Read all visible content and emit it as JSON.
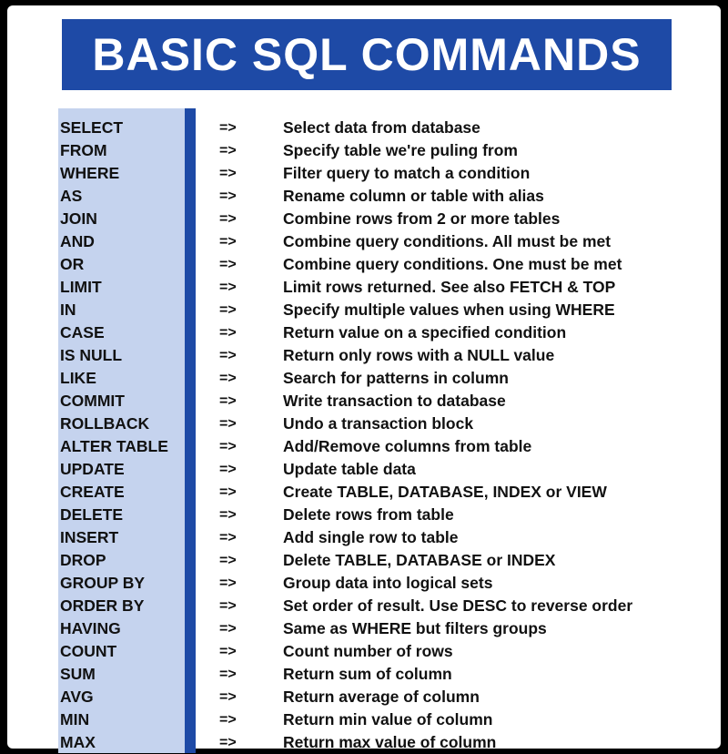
{
  "title": "BASIC SQL COMMANDS",
  "colors": {
    "accent_blue": "#1e4aa6",
    "command_panel": "#c5d3ee",
    "text": "#111111",
    "background": "#ffffff"
  },
  "commands": [
    {
      "command": "SELECT",
      "arrow": "=>",
      "description": "Select data from database"
    },
    {
      "command": "FROM",
      "arrow": "=>",
      "description": "Specify table we're puling from"
    },
    {
      "command": "WHERE",
      "arrow": "=>",
      "description": "Filter query to match a condition"
    },
    {
      "command": "AS",
      "arrow": "=>",
      "description": "Rename column or table with alias"
    },
    {
      "command": "JOIN",
      "arrow": "=>",
      "description": "Combine rows from 2 or more tables"
    },
    {
      "command": "AND",
      "arrow": "=>",
      "description": "Combine query conditions. All must be met"
    },
    {
      "command": "OR",
      "arrow": "=>",
      "description": "Combine query conditions. One must be met"
    },
    {
      "command": "LIMIT",
      "arrow": "=>",
      "description": "Limit rows returned. See also FETCH & TOP"
    },
    {
      "command": "IN",
      "arrow": "=>",
      "description": "Specify multiple values when using WHERE"
    },
    {
      "command": "CASE",
      "arrow": "=>",
      "description": "Return value on a specified condition"
    },
    {
      "command": "IS NULL",
      "arrow": "=>",
      "description": "Return only rows with a NULL value"
    },
    {
      "command": "LIKE",
      "arrow": "=>",
      "description": "Search for patterns in column"
    },
    {
      "command": "COMMIT",
      "arrow": "=>",
      "description": "Write transaction to database"
    },
    {
      "command": "ROLLBACK",
      "arrow": "=>",
      "description": "Undo a transaction block"
    },
    {
      "command": "ALTER TABLE",
      "arrow": "=>",
      "description": "Add/Remove columns from table"
    },
    {
      "command": "UPDATE",
      "arrow": "=>",
      "description": "Update table data"
    },
    {
      "command": "CREATE",
      "arrow": "=>",
      "description": "Create TABLE, DATABASE, INDEX or VIEW"
    },
    {
      "command": "DELETE",
      "arrow": "=>",
      "description": "Delete rows from table"
    },
    {
      "command": "INSERT",
      "arrow": "=>",
      "description": "Add single row to table"
    },
    {
      "command": "DROP",
      "arrow": "=>",
      "description": "Delete TABLE, DATABASE or INDEX"
    },
    {
      "command": "GROUP BY",
      "arrow": "=>",
      "description": "Group data into logical sets"
    },
    {
      "command": "ORDER BY",
      "arrow": "=>",
      "description": "Set order of result. Use DESC to reverse order"
    },
    {
      "command": "HAVING",
      "arrow": "=>",
      "description": "Same as WHERE but filters groups"
    },
    {
      "command": "COUNT",
      "arrow": "=>",
      "description": "Count number of rows"
    },
    {
      "command": "SUM",
      "arrow": "=>",
      "description": "Return sum of column"
    },
    {
      "command": "AVG",
      "arrow": "=>",
      "description": "Return average of column"
    },
    {
      "command": "MIN",
      "arrow": "=>",
      "description": "Return min value of column"
    },
    {
      "command": "MAX",
      "arrow": "=>",
      "description": "Return max value of column"
    }
  ]
}
